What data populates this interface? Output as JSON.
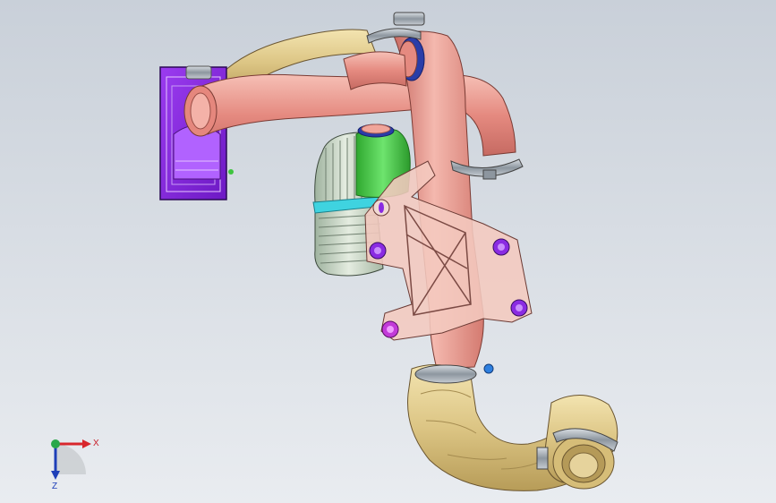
{
  "viewport": {
    "background_top": "#c9d0d9",
    "background_bottom": "#e9ecf0"
  },
  "model": {
    "parts": [
      {
        "name": "filter-housing",
        "color": "#8a2be2"
      },
      {
        "name": "intake-pipe",
        "color": "#e8948a"
      },
      {
        "name": "flex-hose",
        "color": "#e0cc8a"
      },
      {
        "name": "intercooler-tank",
        "color": "#3ec43e"
      },
      {
        "name": "intercooler-core",
        "color": "#c9d6c9"
      },
      {
        "name": "mounting-bracket",
        "color": "#f4c9bf"
      },
      {
        "name": "hose-clamp",
        "color": "#9aa3ad"
      }
    ]
  },
  "triad": {
    "x_label": "X",
    "z_label": "Z",
    "x_color": "#d8262c",
    "y_color": "#2aa84a",
    "z_color": "#1e3fb8"
  }
}
